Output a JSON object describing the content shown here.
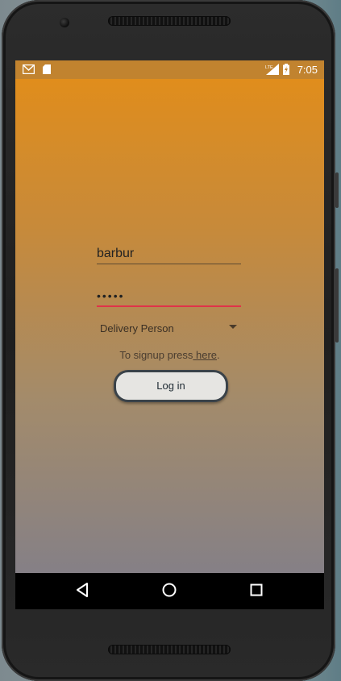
{
  "status_bar": {
    "time": "7:05",
    "left_icons": [
      "gmail-icon",
      "sd-card-icon"
    ],
    "right_icons": [
      "lte-signal-icon",
      "battery-charging-icon"
    ],
    "lte_label": "LTE"
  },
  "login": {
    "username_value": "barbur",
    "password_value": "•••••",
    "role_selected": "Delivery Person",
    "signup_prefix": "To signup press",
    "signup_link": " here",
    "signup_suffix": ".",
    "login_label": "Log in"
  },
  "colors": {
    "status_bar": "#c1832f",
    "gradient_top": "#e08d1c",
    "gradient_bottom": "#858086",
    "password_underline": "#e0334a",
    "nav_bar": "#000000"
  },
  "nav_bar": {
    "icons": [
      "back-icon",
      "home-icon",
      "recents-icon"
    ]
  }
}
